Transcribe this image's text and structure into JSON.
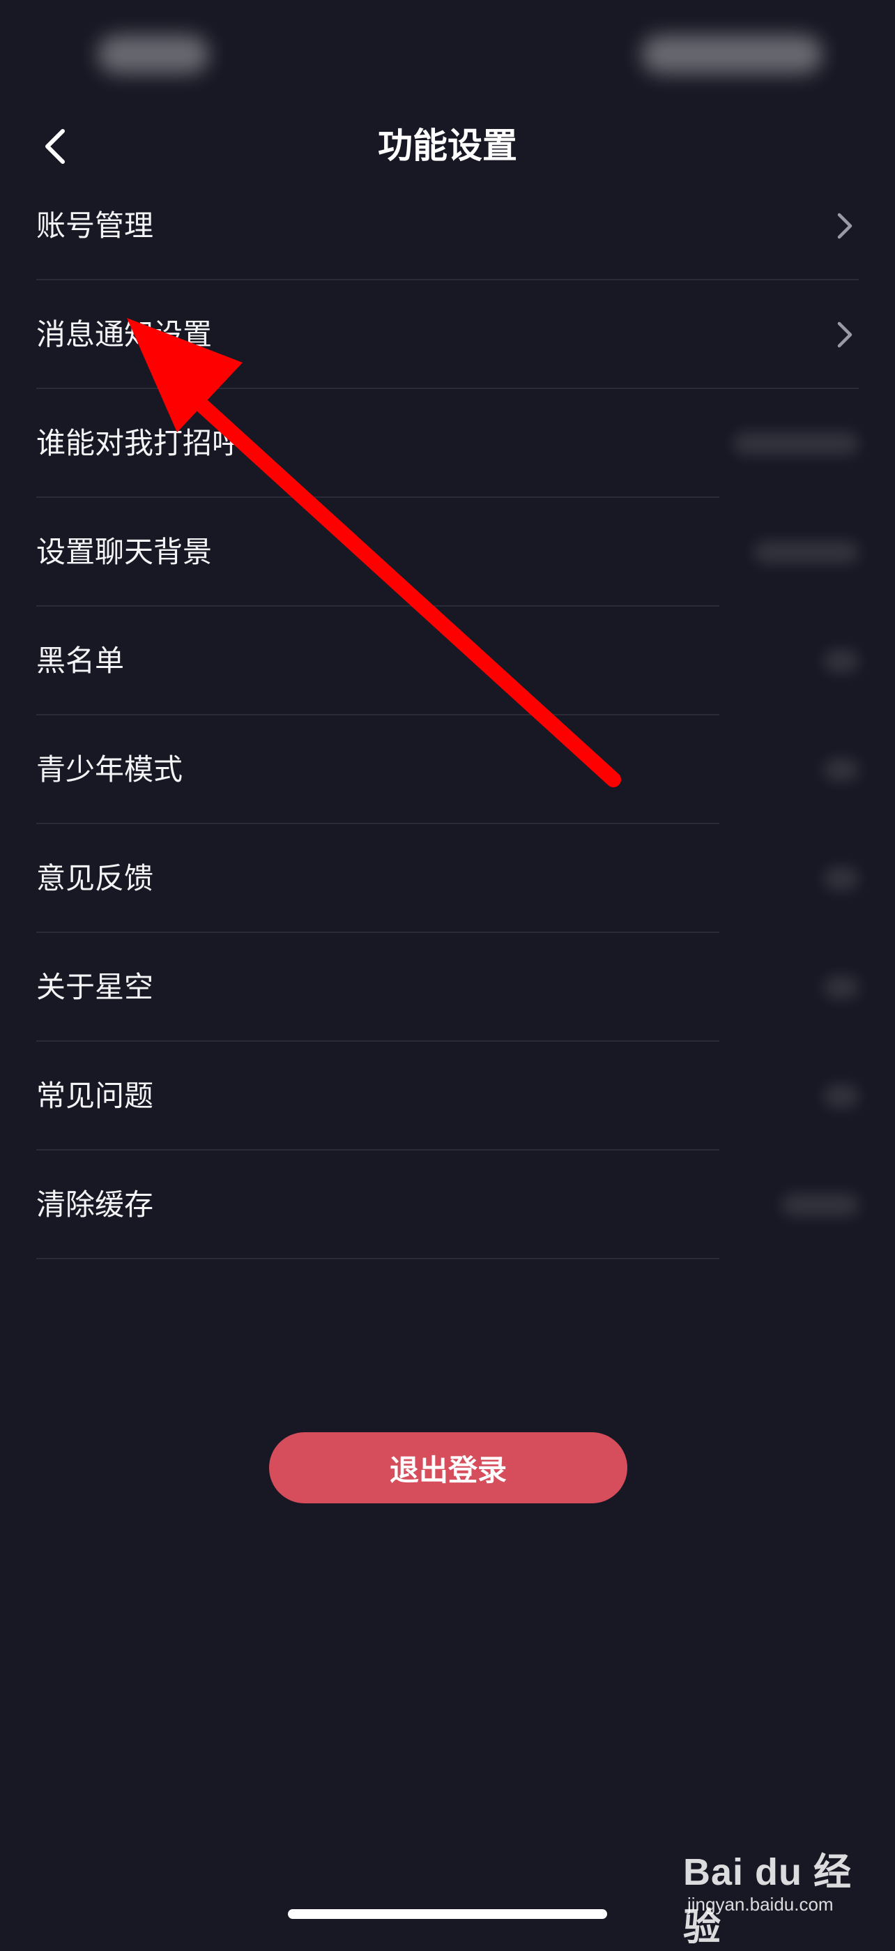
{
  "header": {
    "title": "功能设置",
    "back_icon": "chevron-left-icon"
  },
  "settings": {
    "items": [
      {
        "label": "账号管理",
        "icon": "chevron-right-icon"
      },
      {
        "label": "消息通知设置",
        "icon": "chevron-right-icon"
      },
      {
        "label": "谁能对我打招呼"
      },
      {
        "label": "设置聊天背景"
      },
      {
        "label": "黑名单"
      },
      {
        "label": "青少年模式"
      },
      {
        "label": "意见反馈"
      },
      {
        "label": "关于星空"
      },
      {
        "label": "常见问题"
      },
      {
        "label": "清除缓存"
      }
    ]
  },
  "actions": {
    "logout_label": "退出登录"
  },
  "watermark": {
    "logo": "Bai du 经验",
    "url": "jingyan.baidu.com"
  },
  "colors": {
    "background": "#181824",
    "divider": "#2b2b38",
    "logout_button": "#d64d5c",
    "annotation_arrow": "#ff0000"
  }
}
